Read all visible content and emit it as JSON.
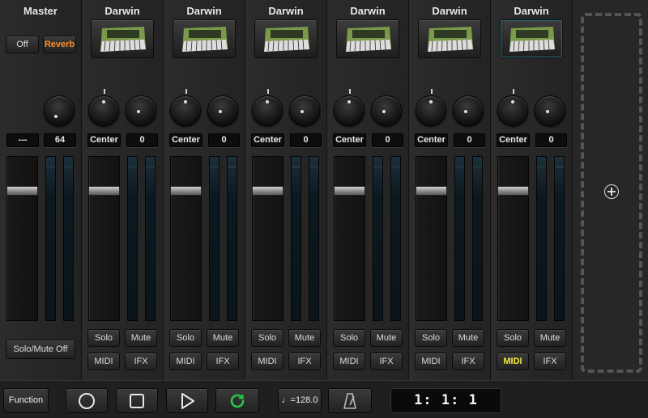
{
  "master": {
    "title": "Master",
    "off_label": "Off",
    "reverb_label": "Reverb",
    "readout_left": "---",
    "readout_right": "64",
    "solo_mute_off_label": "Solo/Mute Off"
  },
  "tracks": [
    {
      "title": "Darwin",
      "pan": "Center",
      "value": "0",
      "solo": "Solo",
      "mute": "Mute",
      "midi": "MIDI",
      "ifx": "IFX"
    },
    {
      "title": "Darwin",
      "pan": "Center",
      "value": "0",
      "solo": "Solo",
      "mute": "Mute",
      "midi": "MIDI",
      "ifx": "IFX"
    },
    {
      "title": "Darwin",
      "pan": "Center",
      "value": "0",
      "solo": "Solo",
      "mute": "Mute",
      "midi": "MIDI",
      "ifx": "IFX"
    },
    {
      "title": "Darwin",
      "pan": "Center",
      "value": "0",
      "solo": "Solo",
      "mute": "Mute",
      "midi": "MIDI",
      "ifx": "IFX"
    },
    {
      "title": "Darwin",
      "pan": "Center",
      "value": "0",
      "solo": "Solo",
      "mute": "Mute",
      "midi": "MIDI",
      "ifx": "IFX"
    },
    {
      "title": "Darwin",
      "pan": "Center",
      "value": "0",
      "solo": "Solo",
      "mute": "Mute",
      "midi": "MIDI",
      "ifx": "IFX"
    }
  ],
  "transport": {
    "function_label": "Function",
    "tempo": "♩=128.0",
    "position": "1:   1:   1"
  },
  "colors": {
    "reverb_accent": "#ff8a2a",
    "midi_active": "#f2ea3a",
    "loop_green": "#2ec24a"
  },
  "icons": {
    "record": "circle-icon",
    "stop": "square-icon",
    "play": "play-icon",
    "loop": "loop-icon",
    "metronome": "metronome-icon",
    "add_track": "plus-icon"
  }
}
